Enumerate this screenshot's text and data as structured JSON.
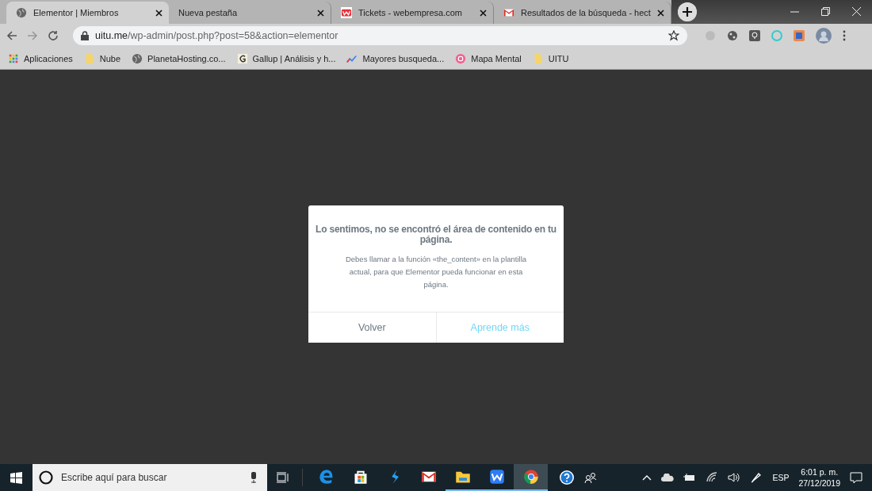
{
  "tabs": [
    {
      "title": "Elementor | Miembros",
      "selected": true
    },
    {
      "title": "Nueva pestaña",
      "selected": false
    },
    {
      "title": "Tickets - webempresa.com",
      "selected": false
    },
    {
      "title": "Resultados de la búsqueda - hect",
      "selected": false
    }
  ],
  "address": {
    "host": "uitu.me",
    "path": "/wp-admin/post.php?post=58&action=elementor"
  },
  "bookmarks": [
    {
      "label": "Aplicaciones"
    },
    {
      "label": "Nube"
    },
    {
      "label": "PlanetaHosting.co..."
    },
    {
      "label": "Gallup | Análisis y h..."
    },
    {
      "label": "Mayores busqueda..."
    },
    {
      "label": "Mapa Mental"
    },
    {
      "label": "UITU"
    }
  ],
  "dialog": {
    "title": "Lo sentimos, no se encontró el área de contenido en tu página.",
    "message": "Debes llamar a la función «the_content» en la plantilla actual, para que Elementor pueda funcionar en esta página.",
    "buttons": [
      {
        "label": "Volver",
        "kind": "secondary"
      },
      {
        "label": "Aprende más",
        "kind": "primary"
      }
    ]
  },
  "taskbar": {
    "search_placeholder": "Escribe aquí para buscar",
    "apps": [
      {
        "running": false,
        "selected": false
      },
      {
        "running": false,
        "selected": false
      },
      {
        "running": false,
        "selected": false
      },
      {
        "running": false,
        "selected": false
      },
      {
        "running": true,
        "selected": false
      },
      {
        "running": true,
        "selected": false
      },
      {
        "running": true,
        "selected": true
      }
    ],
    "language": "ESP",
    "time": "6:01 p. m.",
    "date": "27/12/2019"
  }
}
